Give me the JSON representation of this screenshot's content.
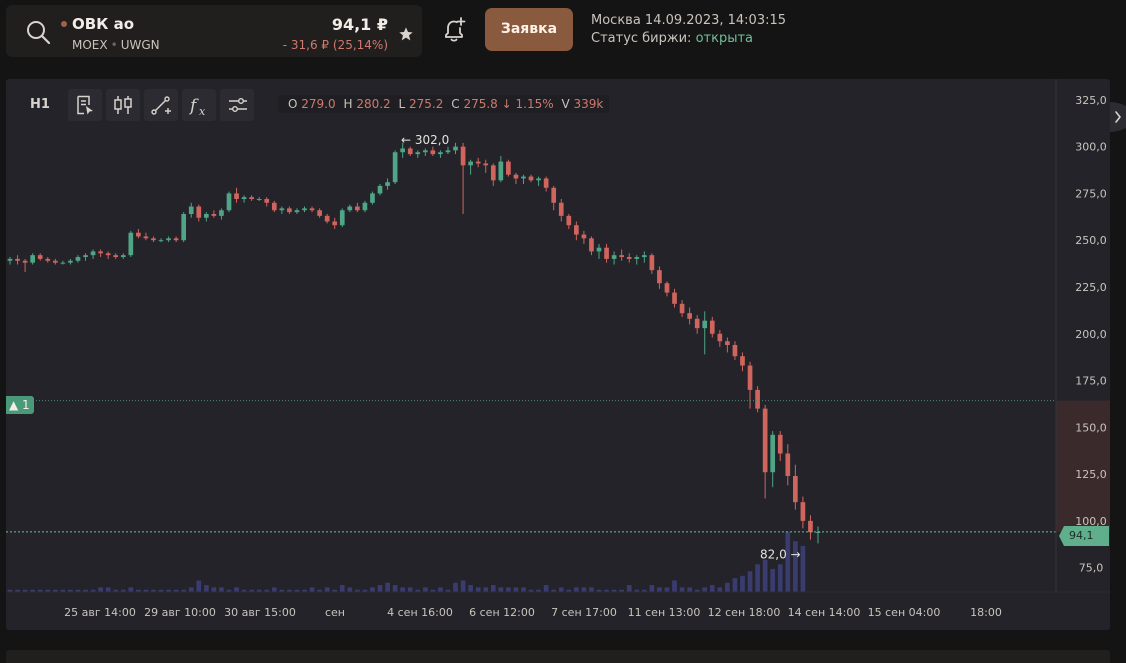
{
  "instrument": {
    "name": "ОВК ао",
    "exchange": "MOEX",
    "ticker": "UWGN",
    "price": "94,1 ₽",
    "change": "- 31,6 ₽ (25,14%)"
  },
  "order_button": {
    "label": "Заявка"
  },
  "market": {
    "time": "Москва 14.09.2023, 14:03:15",
    "status_label": "Статус биржи: ",
    "status_value": "открыта"
  },
  "toolbar": {
    "timeframe": "H1",
    "tools": [
      "notes-icon",
      "candles-icon",
      "drawing-icon",
      "indicators-icon",
      "settings-icon"
    ]
  },
  "ohlc": {
    "o_key": "O",
    "o": "279.0",
    "h_key": "H",
    "h": "280.2",
    "l_key": "L",
    "l": "275.2",
    "c_key": "C",
    "c": "275.8",
    "change": "↓ 1.15%",
    "v_key": "V",
    "v": "339k"
  },
  "alert": {
    "label": "▲ 1",
    "price": 164.3
  },
  "current_price_tag": "94,1",
  "colors": {
    "up": "#4fa586",
    "down": "#d0655e",
    "volume": "#3a3c70",
    "grid_dash": "#4a8a72",
    "bg": "#232329",
    "accent": "#8a5a3e"
  },
  "chart_data": {
    "type": "candlestick",
    "ylim": [
      62,
      334
    ],
    "y_ticks": [
      "325,0",
      "300,0",
      "275,0",
      "250,0",
      "225,0",
      "200,0",
      "175,0",
      "150,0",
      "125,0",
      "100,0",
      "75,0"
    ],
    "y_tick_values": [
      325,
      300,
      275,
      250,
      225,
      200,
      175,
      150,
      125,
      100,
      75
    ],
    "x_tick_labels": [
      "25 авг 14:00",
      "29 авг 10:00",
      "30 авг 15:00",
      "сен",
      "4 сен 16:00",
      "6 сен 12:00",
      "7 сен 17:00",
      "11 сен 13:00",
      "12 сен 18:00",
      "14 сен 14:00",
      "15 сен 04:00",
      "18:00"
    ],
    "annotations": [
      {
        "text": "← 302,0",
        "value": 302.0
      },
      {
        "text": "82,0 →",
        "value": 82.0
      }
    ],
    "current_price": 94.1,
    "candles": [
      [
        239,
        241,
        237,
        240
      ],
      [
        240,
        242,
        237,
        239
      ],
      [
        239,
        240,
        233,
        238
      ],
      [
        238,
        243,
        237,
        242
      ],
      [
        242,
        243,
        239,
        240
      ],
      [
        240,
        241,
        238,
        239
      ],
      [
        239,
        240,
        237,
        238
      ],
      [
        238,
        239,
        237,
        238
      ],
      [
        238,
        240,
        237,
        239
      ],
      [
        239,
        242,
        238,
        241
      ],
      [
        241,
        243,
        239,
        242
      ],
      [
        242,
        245,
        240,
        244
      ],
      [
        244,
        245,
        241,
        243
      ],
      [
        243,
        244,
        240,
        242
      ],
      [
        242,
        243,
        240,
        241
      ],
      [
        241,
        243,
        240,
        242
      ],
      [
        242,
        255,
        241,
        254
      ],
      [
        254,
        256,
        251,
        252
      ],
      [
        252,
        254,
        250,
        251
      ],
      [
        251,
        252,
        249,
        250
      ],
      [
        250,
        251,
        249,
        250
      ],
      [
        250,
        252,
        249,
        251
      ],
      [
        251,
        252,
        249,
        250
      ],
      [
        250,
        265,
        249,
        264
      ],
      [
        264,
        270,
        262,
        268
      ],
      [
        268,
        269,
        260,
        262
      ],
      [
        262,
        265,
        260,
        264
      ],
      [
        264,
        266,
        262,
        263
      ],
      [
        263,
        267,
        261,
        266
      ],
      [
        266,
        276,
        265,
        275
      ],
      [
        275,
        278,
        270,
        272
      ],
      [
        272,
        274,
        270,
        273
      ],
      [
        273,
        274,
        271,
        272
      ],
      [
        272,
        273,
        271,
        272
      ],
      [
        272,
        273,
        268,
        270
      ],
      [
        270,
        271,
        265,
        266
      ],
      [
        266,
        268,
        264,
        267
      ],
      [
        267,
        268,
        264,
        265
      ],
      [
        265,
        267,
        264,
        266
      ],
      [
        266,
        268,
        265,
        267
      ],
      [
        267,
        268,
        265,
        266
      ],
      [
        266,
        267,
        262,
        263
      ],
      [
        263,
        264,
        259,
        260
      ],
      [
        260,
        262,
        256,
        258
      ],
      [
        258,
        267,
        257,
        266
      ],
      [
        266,
        269,
        265,
        268
      ],
      [
        268,
        270,
        265,
        266
      ],
      [
        266,
        271,
        265,
        270
      ],
      [
        270,
        276,
        269,
        275
      ],
      [
        275,
        280,
        274,
        279
      ],
      [
        279,
        283,
        277,
        281
      ],
      [
        281,
        298,
        280,
        297
      ],
      [
        297,
        302,
        294,
        299
      ],
      [
        299,
        300,
        295,
        296
      ],
      [
        296,
        298,
        294,
        297
      ],
      [
        297,
        299,
        295,
        298
      ],
      [
        298,
        300,
        295,
        296
      ],
      [
        296,
        298,
        294,
        297
      ],
      [
        297,
        300,
        296,
        298
      ],
      [
        298,
        302,
        296,
        300
      ],
      [
        300,
        302,
        264,
        290
      ],
      [
        290,
        293,
        285,
        292
      ],
      [
        292,
        294,
        289,
        291
      ],
      [
        291,
        293,
        286,
        290
      ],
      [
        290,
        291,
        279,
        282
      ],
      [
        282,
        295,
        281,
        292
      ],
      [
        292,
        293,
        284,
        285
      ],
      [
        285,
        286,
        280,
        283
      ],
      [
        283,
        285,
        280,
        284
      ],
      [
        284,
        285,
        281,
        282
      ],
      [
        282,
        284,
        279,
        283
      ],
      [
        283,
        284,
        276,
        278
      ],
      [
        278,
        279,
        266,
        270
      ],
      [
        270,
        272,
        260,
        263
      ],
      [
        263,
        264,
        256,
        258
      ],
      [
        258,
        260,
        250,
        253
      ],
      [
        253,
        255,
        248,
        251
      ],
      [
        251,
        252,
        242,
        244
      ],
      [
        244,
        248,
        240,
        246
      ],
      [
        246,
        248,
        238,
        240
      ],
      [
        240,
        244,
        237,
        242
      ],
      [
        242,
        245,
        239,
        241
      ],
      [
        241,
        243,
        238,
        240
      ],
      [
        240,
        242,
        237,
        241
      ],
      [
        241,
        244,
        238,
        242
      ],
      [
        242,
        243,
        232,
        234
      ],
      [
        234,
        236,
        224,
        227
      ],
      [
        227,
        228,
        220,
        222
      ],
      [
        222,
        224,
        214,
        216
      ],
      [
        216,
        218,
        209,
        211
      ],
      [
        211,
        214,
        205,
        208
      ],
      [
        208,
        210,
        200,
        203
      ],
      [
        203,
        212,
        189,
        207
      ],
      [
        207,
        209,
        198,
        200
      ],
      [
        200,
        202,
        193,
        196
      ],
      [
        196,
        198,
        190,
        194
      ],
      [
        194,
        196,
        186,
        188
      ],
      [
        188,
        190,
        180,
        183
      ],
      [
        183,
        185,
        160,
        170
      ],
      [
        170,
        172,
        158,
        160
      ],
      [
        160,
        162,
        112,
        126
      ],
      [
        126,
        148,
        118,
        146
      ],
      [
        146,
        148,
        132,
        136
      ],
      [
        136,
        141,
        119,
        124
      ],
      [
        124,
        130,
        106,
        110
      ],
      [
        110,
        113,
        96,
        100
      ],
      [
        100,
        103,
        90,
        94
      ],
      [
        94,
        97,
        88,
        94.1
      ]
    ],
    "volumes": [
      1,
      1,
      1,
      1,
      1,
      1,
      1,
      1,
      1,
      1,
      1,
      1,
      2,
      2,
      1,
      1,
      2,
      1,
      1,
      1,
      1,
      1,
      1,
      1,
      2,
      5,
      3,
      2,
      2,
      1,
      2,
      1,
      1,
      1,
      1,
      2,
      1,
      1,
      1,
      1,
      2,
      1,
      2,
      1,
      3,
      2,
      1,
      1,
      2,
      3,
      4,
      3,
      2,
      2,
      1,
      2,
      1,
      2,
      1,
      4,
      5,
      3,
      2,
      2,
      3,
      2,
      2,
      2,
      2,
      1,
      1,
      3,
      1,
      2,
      1,
      2,
      2,
      2,
      1,
      1,
      1,
      1,
      3,
      1,
      1,
      3,
      2,
      2,
      5,
      2,
      2,
      1,
      2,
      3,
      2,
      4,
      6,
      7,
      9,
      12,
      14,
      10,
      12,
      26,
      22,
      20
    ]
  }
}
